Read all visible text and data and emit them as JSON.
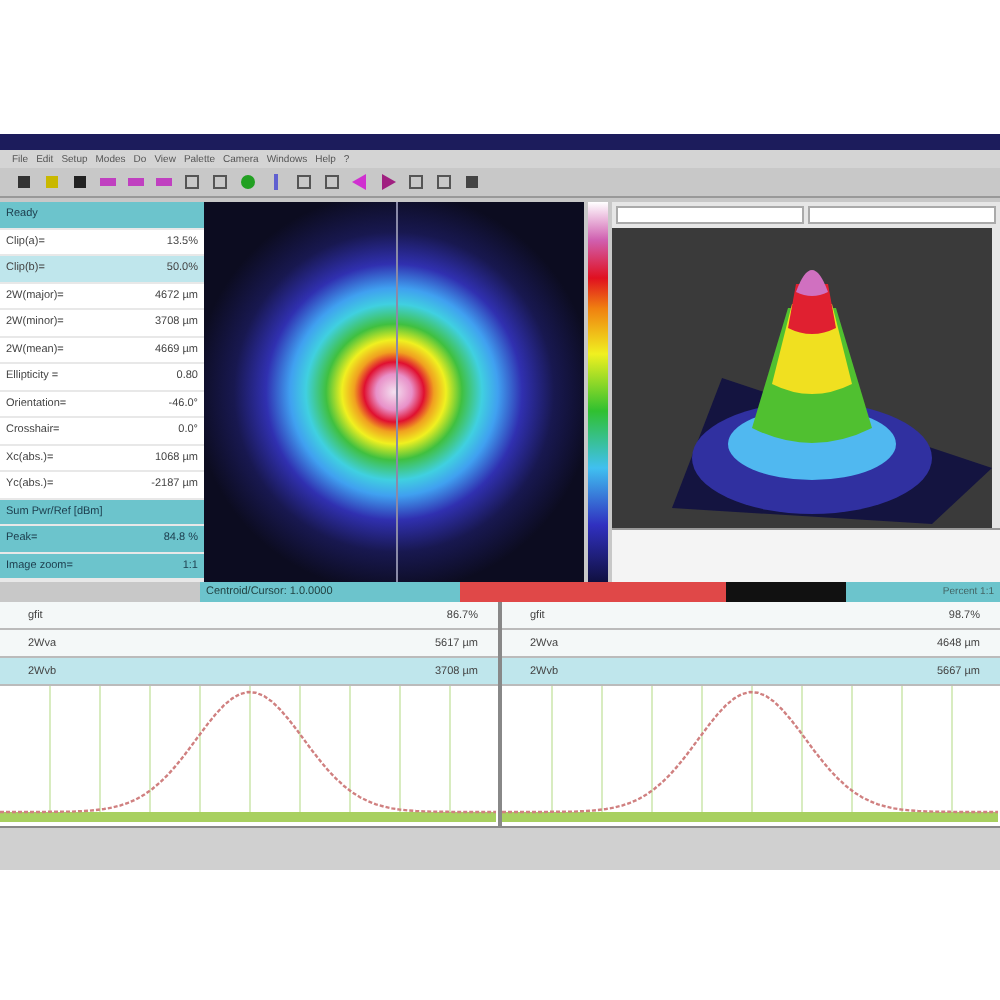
{
  "menu": [
    "File",
    "Edit",
    "Setup",
    "Modes",
    "Do",
    "View",
    "Palette",
    "Camera",
    "Windows",
    "Help",
    "?"
  ],
  "left_panel": [
    {
      "kind": "header",
      "label": "Ready"
    },
    {
      "kind": "row",
      "label": "Clip(a)=",
      "value": "13.5%"
    },
    {
      "kind": "band",
      "label": "Clip(b)=",
      "value": "50.0%"
    },
    {
      "kind": "row",
      "label": "2W(major)=",
      "value": "4672 µm"
    },
    {
      "kind": "row",
      "label": "2W(minor)=",
      "value": "3708 µm"
    },
    {
      "kind": "row",
      "label": "2W(mean)=",
      "value": "4669 µm"
    },
    {
      "kind": "row",
      "label": "Ellipticity =",
      "value": "0.80"
    },
    {
      "kind": "row",
      "label": "Orientation=",
      "value": "-46.0°"
    },
    {
      "kind": "row",
      "label": "Crosshair=",
      "value": "0.0°"
    },
    {
      "kind": "row",
      "label": "Xc(abs.)=",
      "value": "1068 µm"
    },
    {
      "kind": "row",
      "label": "Yc(abs.)=",
      "value": "-2187 µm"
    },
    {
      "kind": "header",
      "label": "Sum Pwr/Ref [dBm]"
    },
    {
      "kind": "header",
      "label": "Peak=",
      "value": "84.8 %"
    },
    {
      "kind": "header",
      "label": "Image zoom=",
      "value": "1:1"
    }
  ],
  "centroid_bar": {
    "label": "Centroid/Cursor: 1.0.0000",
    "level": 0.69,
    "right_label": "Percent 1:1"
  },
  "profiles": [
    {
      "rows": [
        {
          "kind": "row",
          "label": "gfit",
          "value": "86.7%"
        },
        {
          "kind": "row",
          "label": "2Wva",
          "value": "5617 µm"
        },
        {
          "kind": "band",
          "label": "2Wvb",
          "value": "3708 µm"
        }
      ]
    },
    {
      "rows": [
        {
          "kind": "row",
          "label": "gfit",
          "value": "98.7%"
        },
        {
          "kind": "row",
          "label": "2Wva",
          "value": "4648 µm"
        },
        {
          "kind": "band",
          "label": "2Wvb",
          "value": "5667 µm"
        }
      ]
    }
  ]
}
